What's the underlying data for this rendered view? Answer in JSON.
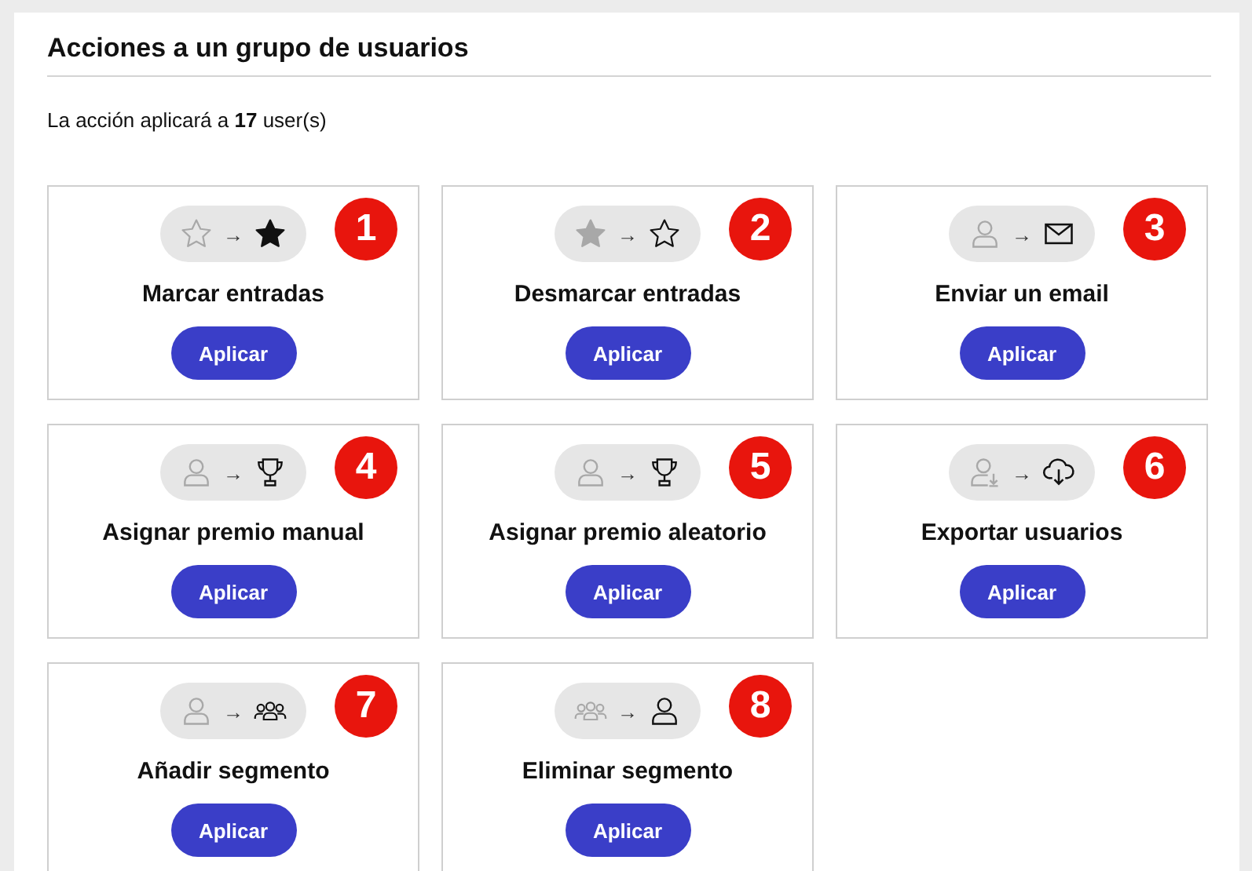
{
  "title": "Acciones a un grupo de usuarios",
  "summary": "La acción aplicará a **17** user(s)",
  "actions": [
    {
      "badge": "1",
      "icons": [
        {
          "kind": "star-outline"
        },
        {
          "kind": "star-filled"
        }
      ],
      "arrow": "→",
      "title": "Marcar entradas",
      "button": "Aplicar"
    },
    {
      "badge": "2",
      "icons": [
        {
          "kind": "star-filled"
        },
        {
          "kind": "star-outline"
        }
      ],
      "arrow": "→",
      "title": "Desmarcar entradas",
      "button": "Aplicar"
    },
    {
      "badge": "3",
      "icons": [
        {
          "kind": "user"
        },
        {
          "kind": "envelope"
        }
      ],
      "arrow": "→",
      "title": "Enviar un email",
      "button": "Aplicar"
    },
    {
      "badge": "4",
      "icons": [
        {
          "kind": "user"
        },
        {
          "kind": "trophy"
        }
      ],
      "arrow": "→",
      "title": "Asignar premio manual",
      "button": "Aplicar"
    },
    {
      "badge": "5",
      "icons": [
        {
          "kind": "user"
        },
        {
          "kind": "trophy"
        }
      ],
      "arrow": "→",
      "title": "Asignar premio aleatorio",
      "button": "Aplicar"
    },
    {
      "badge": "6",
      "icons": [
        {
          "kind": "user-download"
        },
        {
          "kind": "cloud-download"
        }
      ],
      "arrow": "→",
      "title": "Exportar usuarios",
      "button": "Aplicar"
    },
    {
      "badge": "7",
      "icons": [
        {
          "kind": "user"
        },
        {
          "kind": "group"
        }
      ],
      "arrow": "→",
      "title": "Añadir segmento",
      "button": "Aplicar"
    },
    {
      "badge": "8",
      "icons": [
        {
          "kind": "group"
        },
        {
          "kind": "user"
        }
      ],
      "arrow": "→",
      "title": "Eliminar segmento",
      "button": "Aplicar"
    }
  ]
}
